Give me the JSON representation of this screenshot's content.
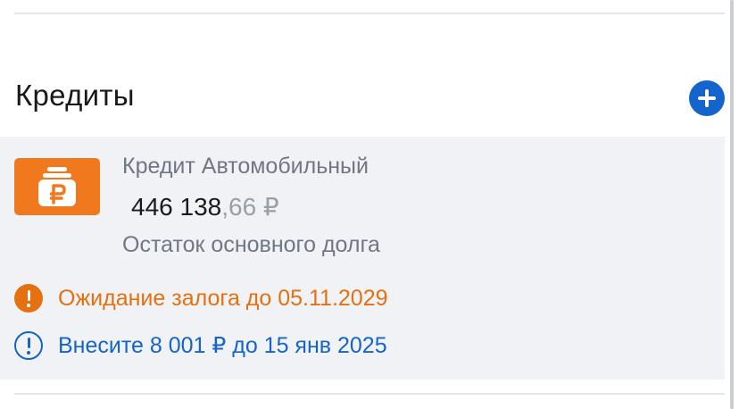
{
  "section": {
    "title": "Кредиты"
  },
  "credit": {
    "name": "Кредит Автомобильный",
    "amount_int": "446 138",
    "amount_frac": ",66",
    "currency": " ₽",
    "amount_label": "Остаток основного долга",
    "icon": "wallet-ruble-icon",
    "icon_color": "#f0791e"
  },
  "alerts": {
    "warning": {
      "text": "Ожидание залога до 05.11.2029",
      "color": "#e47010",
      "icon": "exclamation-circle-filled-icon"
    },
    "payment": {
      "text": "Внесите 8 001 ₽ до 15 янв 2025",
      "color": "#1464cc",
      "icon": "exclamation-circle-outline-icon"
    }
  },
  "colors": {
    "accent": "#1464cc",
    "card_background": "#f1f2f6"
  }
}
